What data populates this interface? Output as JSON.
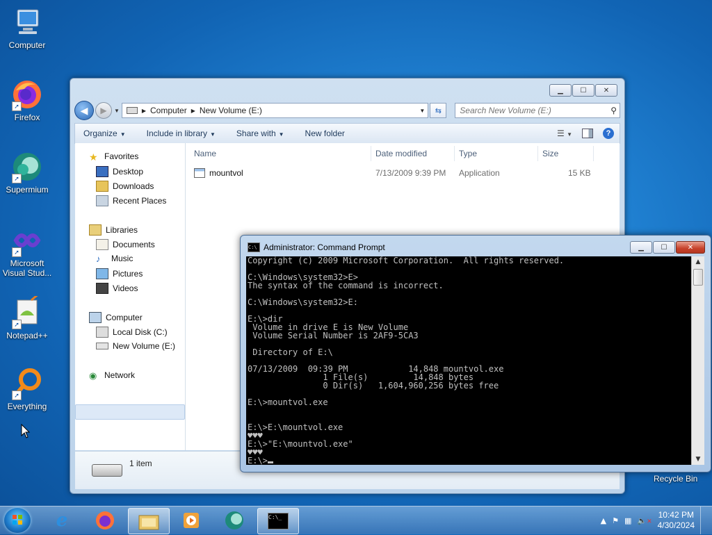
{
  "desktop": {
    "icons": [
      {
        "label": "Computer",
        "name": "computer-desktop-icon"
      },
      {
        "label": "Firefox",
        "name": "firefox-desktop-icon"
      },
      {
        "label": "Supermium",
        "name": "supermium-desktop-icon"
      },
      {
        "label": "Microsoft Visual Stud...",
        "name": "visual-studio-desktop-icon"
      },
      {
        "label": "Notepad++",
        "name": "notepadpp-desktop-icon"
      },
      {
        "label": "Everything",
        "name": "everything-desktop-icon"
      }
    ],
    "recycle_bin_label": "Recycle Bin"
  },
  "explorer": {
    "breadcrumb": [
      "Computer",
      "New Volume (E:)"
    ],
    "search_placeholder": "Search New Volume (E:)",
    "toolbar": {
      "organize": "Organize",
      "include_in_library": "Include in library",
      "share_with": "Share with",
      "new_folder": "New folder"
    },
    "nav": {
      "favorites": "Favorites",
      "favorites_items": [
        "Desktop",
        "Downloads",
        "Recent Places"
      ],
      "libraries": "Libraries",
      "libraries_items": [
        "Documents",
        "Music",
        "Pictures",
        "Videos"
      ],
      "computer": "Computer",
      "computer_items": [
        "Local Disk (C:)",
        "New Volume (E:)"
      ],
      "network": "Network"
    },
    "columns": {
      "name": "Name",
      "date_modified": "Date modified",
      "type": "Type",
      "size": "Size"
    },
    "files": [
      {
        "name": "mountvol",
        "date": "7/13/2009 9:39 PM",
        "type": "Application",
        "size": "15 KB"
      }
    ],
    "status": "1 item"
  },
  "cmd": {
    "title": "Administrator:  Command Prompt",
    "lines": [
      "Copyright (c) 2009 Microsoft Corporation.  All rights reserved.",
      "",
      "C:\\Windows\\system32>E>",
      "The syntax of the command is incorrect.",
      "",
      "C:\\Windows\\system32>E:",
      "",
      "E:\\>dir",
      " Volume in drive E is New Volume",
      " Volume Serial Number is 2AF9-5CA3",
      "",
      " Directory of E:\\",
      "",
      "07/13/2009  09:39 PM            14,848 mountvol.exe",
      "               1 File(s)         14,848 bytes",
      "               0 Dir(s)   1,604,960,256 bytes free",
      "",
      "E:\\>mountvol.exe",
      "",
      "",
      "E:\\>E:\\mountvol.exe",
      "♥♥♥",
      "E:\\>\"E:\\mountvol.exe\"",
      "♥♥♥"
    ],
    "prompt": "E:\\>"
  },
  "tray": {
    "time": "10:42 PM",
    "date": "4/30/2024"
  },
  "colors": {
    "desktop_bg": "#1f7fd0",
    "console_bg": "#000000",
    "console_fg": "#c0c0c0",
    "close_button": "#c7412a"
  }
}
